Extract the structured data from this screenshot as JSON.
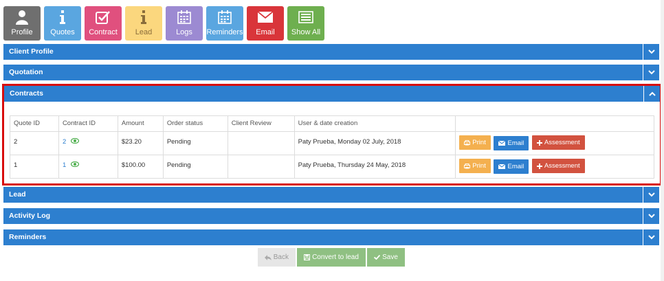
{
  "toolbar": {
    "profile": "Profile",
    "quotes": "Quotes",
    "contract": "Contract",
    "lead": "Lead",
    "logs": "Logs",
    "reminders": "Reminders",
    "email": "Email",
    "show_all": "Show All"
  },
  "sections": {
    "client_profile": "Client Profile",
    "quotation": "Quotation",
    "contracts": "Contracts",
    "lead": "Lead",
    "activity_log": "Activity Log",
    "reminders": "Reminders"
  },
  "contracts_table": {
    "headers": [
      "Quote ID",
      "Contract ID",
      "Amount",
      "Order status",
      "Client Review",
      "User & date creation",
      ""
    ],
    "rows": [
      {
        "quote_id": "2",
        "contract_id": "2",
        "amount": "$23.20",
        "status": "Pending",
        "review": "",
        "user_date": "Paty Prueba, Monday 02 July, 2018"
      },
      {
        "quote_id": "1",
        "contract_id": "1",
        "amount": "$100.00",
        "status": "Pending",
        "review": "",
        "user_date": "Paty Prueba, Thursday 24 May, 2018"
      }
    ],
    "actions": {
      "print": "Print",
      "email": "Email",
      "assessment": "Assessment"
    }
  },
  "footer": {
    "back": "Back",
    "convert": "Convert to lead",
    "save": "Save"
  },
  "colors": {
    "bar": "#2d7fcf",
    "highlight": "#d80d0d"
  }
}
